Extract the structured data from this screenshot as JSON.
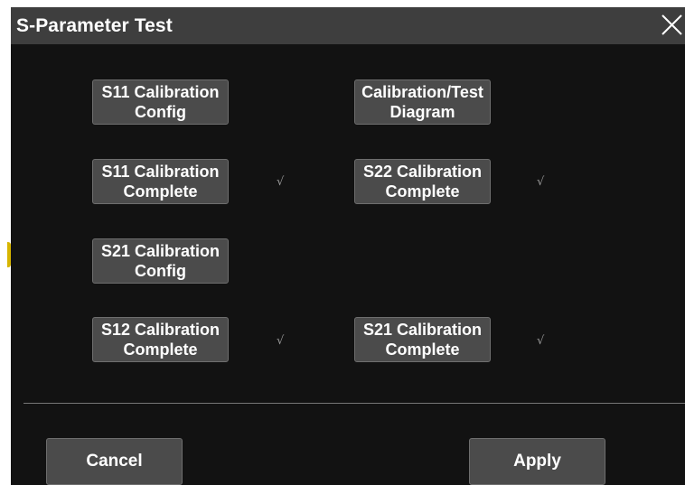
{
  "window": {
    "title": "S-Parameter Test"
  },
  "buttons": {
    "s11_config": {
      "line1": "S11 Calibration",
      "line2": "Config"
    },
    "cal_diagram": {
      "line1": "Calibration/Test",
      "line2": "Diagram"
    },
    "s11_complete": {
      "line1": "S11 Calibration",
      "line2": "Complete"
    },
    "s22_complete": {
      "line1": "S22 Calibration",
      "line2": "Complete"
    },
    "s21_config": {
      "line1": "S21 Calibration",
      "line2": "Config"
    },
    "s12_complete": {
      "line1": "S12 Calibration",
      "line2": "Complete"
    },
    "s21_complete": {
      "line1": "S21 Calibration",
      "line2": "Complete"
    }
  },
  "status": {
    "check_mark": "√"
  },
  "footer": {
    "cancel_label": "Cancel",
    "apply_label": "Apply"
  },
  "colors": {
    "background": "#121212",
    "titlebar": "#3e3e3e",
    "button": "#4b4b4b",
    "button_border": "#6e6e6e",
    "check": "#9a9a9a",
    "side_marker": "#d7b500"
  },
  "icons": {
    "close": "close-icon",
    "check": "checkmark-icon"
  }
}
